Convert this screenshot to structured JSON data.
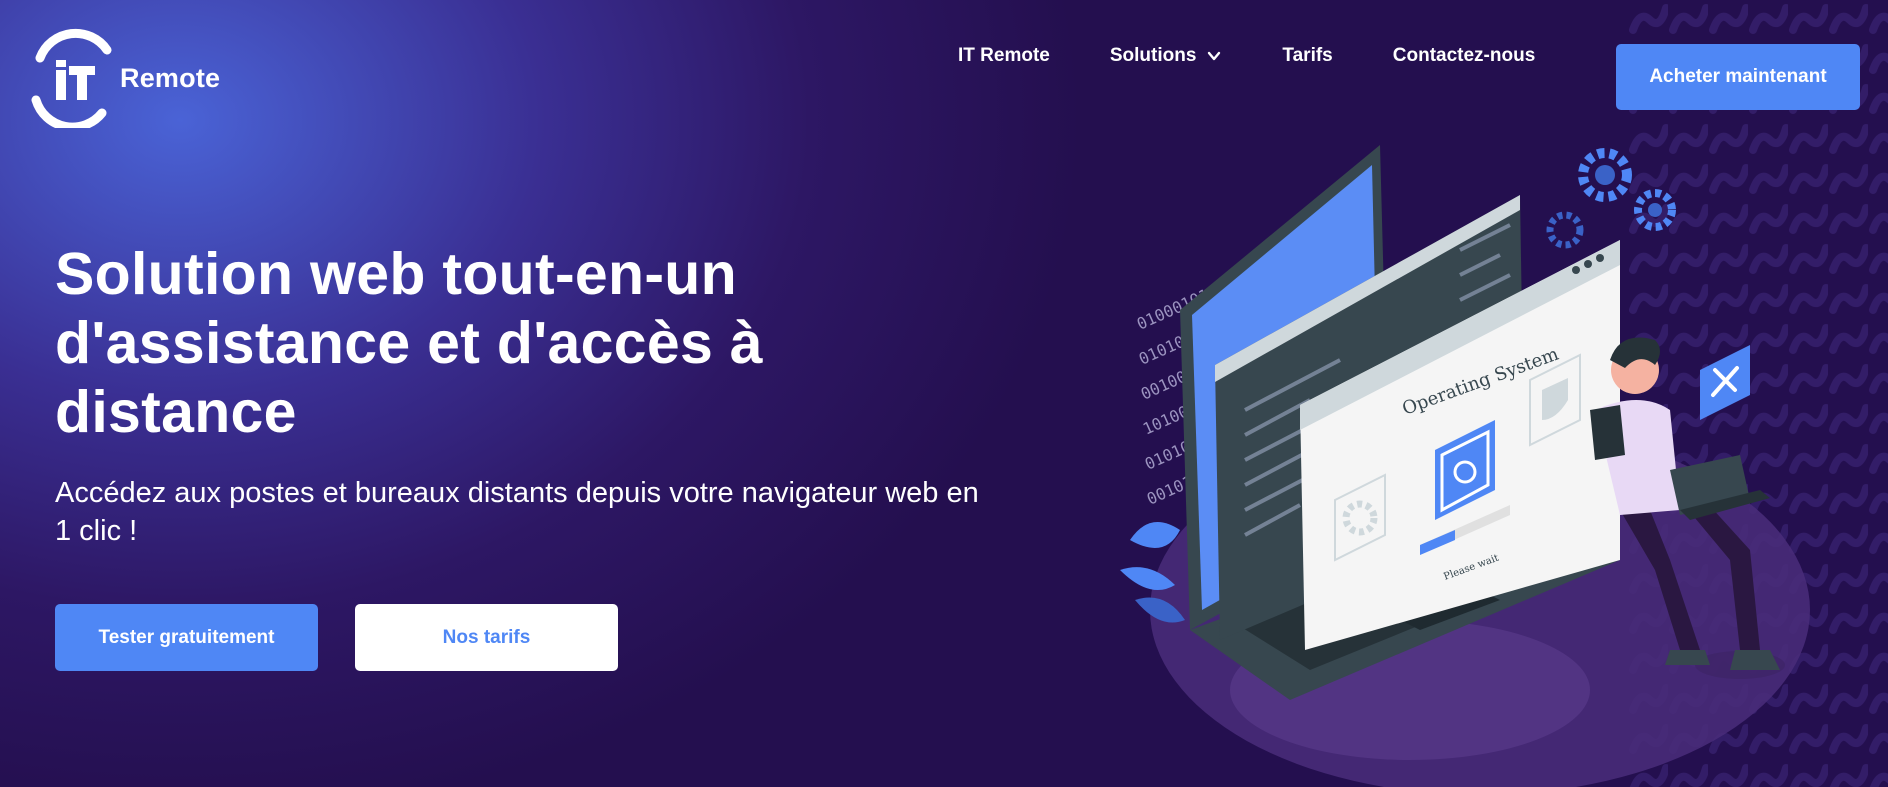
{
  "brand": {
    "logo_letters": "IT",
    "name": "Remote",
    "icon": "it-remote-logo-icon"
  },
  "nav": {
    "items": [
      {
        "label": "IT Remote"
      },
      {
        "label": "Solutions",
        "icon": "chevron-down-icon"
      },
      {
        "label": "Tarifs"
      },
      {
        "label": "Contactez-nous"
      }
    ],
    "cta_label": "Acheter maintenant"
  },
  "hero": {
    "title": "Solution web tout-en-un d'assistance et d'accès à distance",
    "subtitle": "Accédez aux postes et bureaux distants depuis votre navigateur web en 1 clic !",
    "primary_button": "Tester gratuitement",
    "secondary_button": "Nos tarifs"
  },
  "illustration": {
    "window_title": "Operating System",
    "status_text": "Please wait",
    "binary_lines": [
      "01000101010001111",
      "010100011101010",
      "00100101101001",
      "1010011001010",
      "0101010011010",
      "00101010101"
    ],
    "icons": [
      "laptop-icon",
      "gear-icon",
      "shield-icon",
      "tools-icon",
      "person-with-laptop-icon"
    ]
  },
  "colors": {
    "accent": "#4f87f5",
    "background_dark": "#240f4f",
    "background_light": "#4a63d6",
    "white": "#ffffff"
  }
}
